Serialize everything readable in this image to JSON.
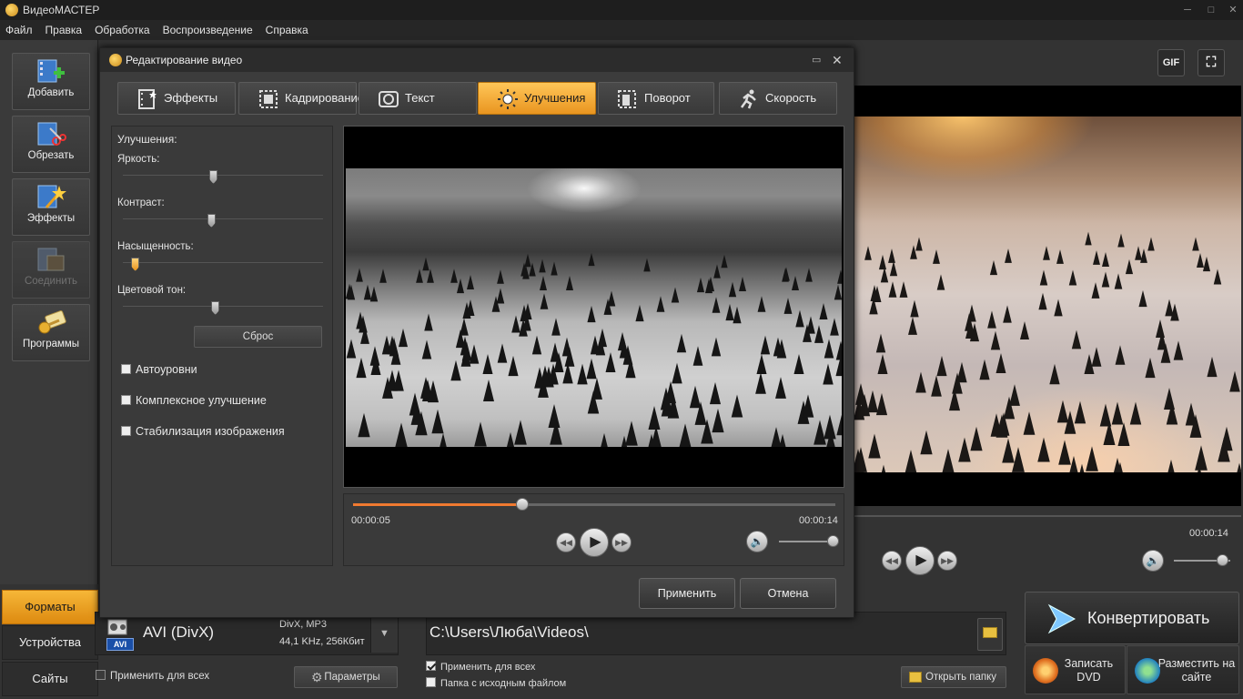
{
  "app": {
    "title": "ВидеоМАСТЕР"
  },
  "window_controls": [
    "─",
    "□",
    "✕"
  ],
  "menu": [
    "Файл",
    "Правка",
    "Обработка",
    "Воспроизведение",
    "Справка"
  ],
  "left_buttons": [
    {
      "label": "Добавить",
      "icon": "add-video-icon",
      "enabled": true
    },
    {
      "label": "Обрезать",
      "icon": "cut-video-icon",
      "enabled": true
    },
    {
      "label": "Эффекты",
      "icon": "effects-wand-icon",
      "enabled": true
    },
    {
      "label": "Соединить",
      "icon": "join-video-icon",
      "enabled": false
    },
    {
      "label": "Программы",
      "icon": "programs-key-icon",
      "enabled": true
    }
  ],
  "bottom_tabs": [
    {
      "label": "Форматы",
      "active": true
    },
    {
      "label": "Устройства",
      "active": false
    },
    {
      "label": "Сайты",
      "active": false
    }
  ],
  "format": {
    "name": "AVI (DivX)",
    "badge": "AVI",
    "codec_line1": "DivX, MP3",
    "codec_line2": "44,1 KHz, 256Кбит",
    "apply_all": "Применить для всех",
    "params_button": "Параметры"
  },
  "output": {
    "path": "C:\\Users\\Люба\\Videos\\",
    "apply_all": "Применить для всех",
    "apply_all_checked": true,
    "source_folder": "Папка с исходным файлом",
    "source_folder_checked": false,
    "open_folder": "Открыть папку"
  },
  "convert": {
    "label": "Конвертировать",
    "dvd": "Записать DVD",
    "web": "Разместить на сайте"
  },
  "right_preview": {
    "time_end": "00:00:14",
    "gif_label": "GIF",
    "volume": 0.85
  },
  "modal": {
    "title": "Редактирование видео",
    "tabs": [
      {
        "label": "Эффекты",
        "icon": "effects-film-icon",
        "active": false
      },
      {
        "label": "Кадрирование",
        "icon": "crop-icon",
        "active": false
      },
      {
        "label": "Текст",
        "icon": "text-icon",
        "active": false
      },
      {
        "label": "Улучшения",
        "icon": "enhance-sun-icon",
        "active": true
      },
      {
        "label": "Поворот",
        "icon": "rotate-icon",
        "active": false
      },
      {
        "label": "Скорость",
        "icon": "speed-runner-icon",
        "active": false
      }
    ],
    "enhance": {
      "heading": "Улучшения:",
      "sliders": [
        {
          "label": "Яркость:",
          "value": 0.45
        },
        {
          "label": "Контраст:",
          "value": 0.44
        },
        {
          "label": "Насыщенность:",
          "value": 0.06
        },
        {
          "label": "Цветовой тон:",
          "value": 0.46
        }
      ],
      "reset": "Сброс",
      "options": [
        {
          "label": "Автоуровни",
          "checked": false
        },
        {
          "label": "Комплексное улучшение",
          "checked": false
        },
        {
          "label": "Стабилизация изображения",
          "checked": false
        }
      ]
    },
    "player": {
      "time_current": "00:00:05",
      "time_end": "00:00:14",
      "progress": 0.35,
      "volume": 0.98
    },
    "apply": "Применить",
    "cancel": "Отмена"
  }
}
